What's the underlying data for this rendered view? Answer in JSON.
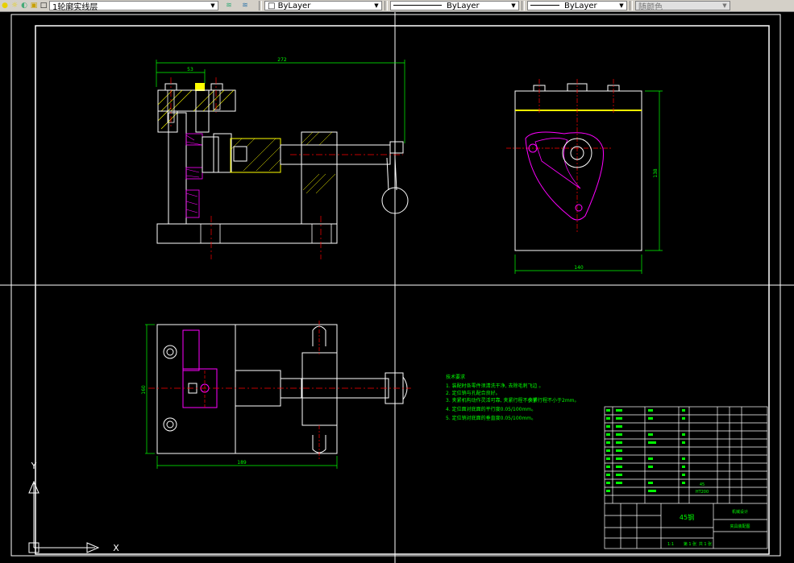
{
  "toolbar": {
    "layer_name": "1轮廓实线层",
    "color_control": "ByLayer",
    "linetype_control": "ByLayer",
    "lineweight_control": "ByLayer",
    "plot_style": "随颜色"
  },
  "dims": {
    "front_width": "272",
    "front_offset": "53",
    "side_height": "138",
    "side_width": "140",
    "top_height": "160",
    "top_width": "189"
  },
  "notes": {
    "title": "技术要求",
    "lines": [
      "1. 装配时各零件须清洗干净, 去除毛刺飞边 。",
      "2. 定位销与孔配合良好。",
      "3. 夹紧机构动作灵活可靠, 夹紧行程不小于",
      "4. 定位面对底面的平行度0.05/100mm。",
      "5. 定位销对底面的垂直度0.05/100mm。"
    ],
    "stroke_note": "夹紧行程不小于2mm。"
  },
  "title_block": {
    "material": "45钢",
    "drawing_name": "夹具装配图",
    "company": "机械设计",
    "part_material": "HT200",
    "part_qty": "45",
    "scale": "1:1",
    "sheet": "第 1 张",
    "sheets": "共 1 张"
  },
  "ucs": {
    "y_label": "Y",
    "x_label": "X"
  }
}
